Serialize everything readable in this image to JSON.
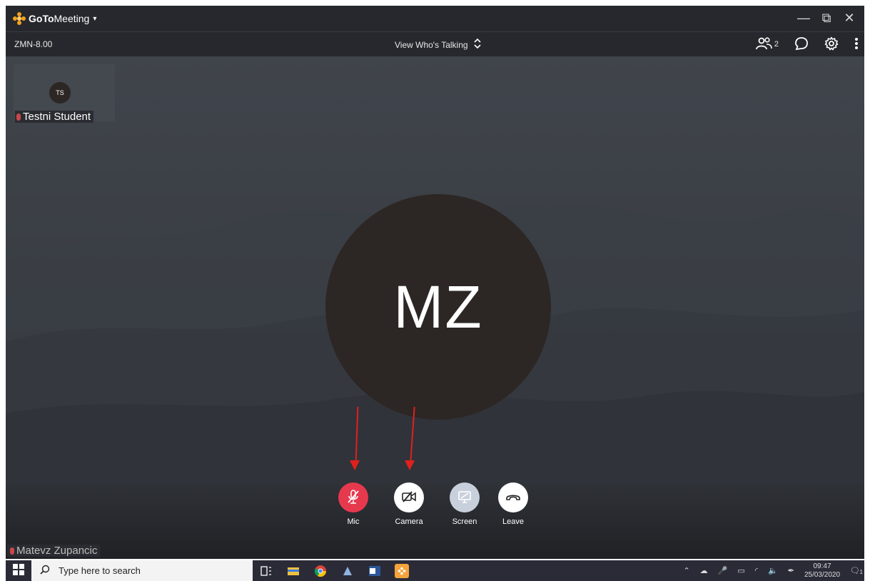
{
  "app": {
    "brand_bold": "GoTo",
    "brand_rest": "Meeting",
    "caret": "▾"
  },
  "window": {
    "minimize": "—",
    "restore": "⧉",
    "close": "✕"
  },
  "toolbar": {
    "meeting_id": "ZMN-8.00",
    "view_mode": "View Who's Talking",
    "participants_count": "2"
  },
  "participants": {
    "thumbnail": {
      "initials": "TS",
      "name": "Testni Student"
    },
    "active_speaker": {
      "initials": "MZ"
    },
    "self": {
      "name": "Matevz Zupancic"
    }
  },
  "controls": [
    {
      "label": "Mic",
      "state": "muted",
      "color": "#e6394d"
    },
    {
      "label": "Camera",
      "state": "off",
      "color": "#ffffff"
    },
    {
      "label": "Screen",
      "state": "disabled",
      "color": "#c8d0dc"
    },
    {
      "label": "Leave",
      "state": "available",
      "color": "#ffffff"
    }
  ],
  "annotations": {
    "arrow_color": "#e0201c"
  },
  "taskbar": {
    "search_placeholder": "Type here to search",
    "time": "09:47",
    "date": "25/03/2020",
    "notification_count": "1"
  }
}
